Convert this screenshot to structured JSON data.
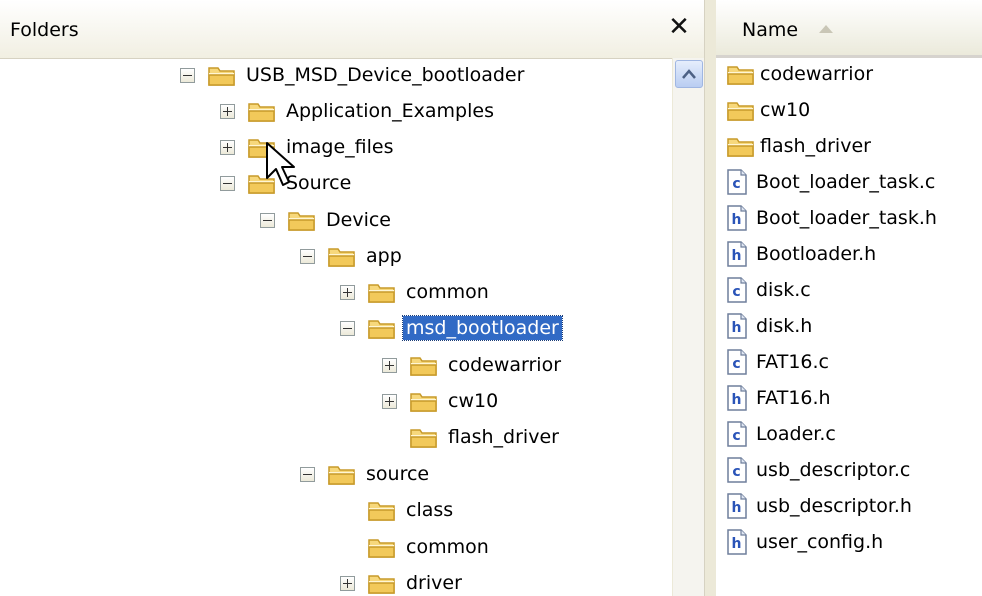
{
  "folders_header": {
    "title": "Folders",
    "close_glyph": "✕"
  },
  "tree": [
    {
      "label": "USB_MSD_Device_bootloader",
      "expander": "minus"
    },
    {
      "label": "Application_Examples",
      "expander": "plus"
    },
    {
      "label": "image_files",
      "expander": "plus"
    },
    {
      "label": "Source",
      "expander": "minus"
    },
    {
      "label": "Device",
      "expander": "minus"
    },
    {
      "label": "app",
      "expander": "minus"
    },
    {
      "label": "common",
      "expander": "plus"
    },
    {
      "label": "msd_bootloader",
      "expander": "minus",
      "selected": true
    },
    {
      "label": "codewarrior",
      "expander": "plus"
    },
    {
      "label": "cw10",
      "expander": "plus"
    },
    {
      "label": "flash_driver",
      "expander": "none"
    },
    {
      "label": "source",
      "expander": "minus"
    },
    {
      "label": "class",
      "expander": "none"
    },
    {
      "label": "common",
      "expander": "none"
    },
    {
      "label": "driver",
      "expander": "plus"
    }
  ],
  "file_list": {
    "column_header": "Name",
    "sort": "ascending",
    "items": [
      {
        "name": "codewarrior",
        "type": "folder"
      },
      {
        "name": "cw10",
        "type": "folder"
      },
      {
        "name": "flash_driver",
        "type": "folder"
      },
      {
        "name": "Boot_loader_task.c",
        "type": "c-file"
      },
      {
        "name": "Boot_loader_task.h",
        "type": "h-file"
      },
      {
        "name": "Bootloader.h",
        "type": "h-file"
      },
      {
        "name": "disk.c",
        "type": "c-file"
      },
      {
        "name": "disk.h",
        "type": "h-file"
      },
      {
        "name": "FAT16.c",
        "type": "c-file"
      },
      {
        "name": "FAT16.h",
        "type": "h-file"
      },
      {
        "name": "Loader.c",
        "type": "c-file"
      },
      {
        "name": "usb_descriptor.c",
        "type": "c-file"
      },
      {
        "name": "usb_descriptor.h",
        "type": "h-file"
      },
      {
        "name": "user_config.h",
        "type": "h-file"
      }
    ]
  },
  "colors": {
    "selection": "#316ac5",
    "folder_fill": "#f7d87c",
    "folder_outline": "#c79a2a",
    "file_letter": "#2a54b8"
  }
}
